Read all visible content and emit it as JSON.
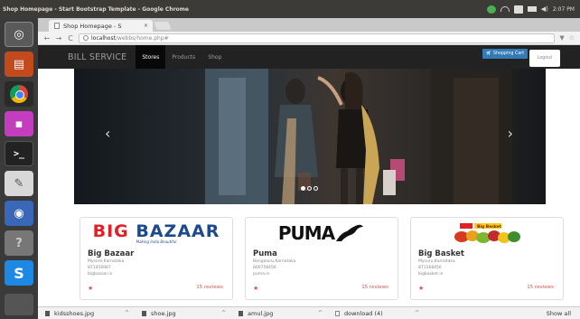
{
  "os": {
    "window_title": "Shop Homepage - Start Bootstrap Template - Google Chrome",
    "clock": "2:07 PM",
    "tray_icons": [
      "chrome-status-icon",
      "wifi-icon",
      "keyboard-icon",
      "mail-icon",
      "sound-icon"
    ]
  },
  "launcher": {
    "items": [
      "dash-icon",
      "files-icon",
      "chrome-icon",
      "media-icon",
      "terminal-icon",
      "text-editor-icon",
      "browser-icon",
      "help-icon",
      "skype-icon"
    ]
  },
  "browser": {
    "tab_title": "Shop Homepage - S",
    "tab_close": "×",
    "url_host": "localhost",
    "url_path": "/webbs/home.php#"
  },
  "navbar": {
    "brand": "BILL SERVICE",
    "links": [
      "Stores",
      "Products",
      "Shop"
    ],
    "active_link": "Stores",
    "cart_label": "Shopping Cart",
    "logout_label": "Logout"
  },
  "carousel": {
    "prev": "‹",
    "next": "›",
    "slides": 3,
    "active_slide": 1
  },
  "stores": [
    {
      "logo_text_1": "BIG",
      "logo_text_2": "BAZAAR",
      "logo_tagline": "Making India Beautiful",
      "name": "Big Bazaar",
      "location": "Mysore,Karnataka",
      "phone": "871456987",
      "site": "bigbazaar.in",
      "reviews": "15 reviews"
    },
    {
      "logo_text": "PUMA",
      "name": "Puma",
      "location": "Bengaluru,Karnataka",
      "phone": "800756456",
      "site": "puma.in",
      "reviews": "15 reviews"
    },
    {
      "logo_text": "Big Basket",
      "name": "Big Basket",
      "location": "Mysuru,Karnataka",
      "phone": "871568456",
      "site": "bigbasket.in",
      "reviews": "15 reviews"
    }
  ],
  "downloads": {
    "items": [
      "kidsshoes.jpg",
      "shoe.jpg",
      "amul.jpg",
      "download (4)"
    ],
    "show_all": "Show all"
  }
}
